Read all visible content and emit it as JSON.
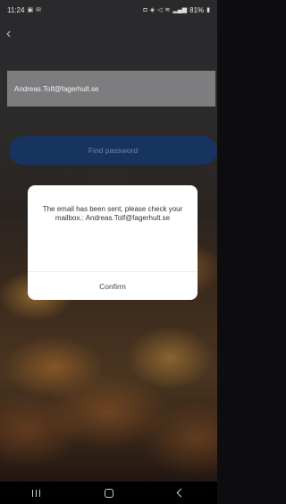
{
  "status_bar": {
    "time": "11:24",
    "battery": "81%",
    "left_icons": [
      "image-icon",
      "mail-icon"
    ],
    "right_icons": [
      "nfc-icon",
      "vibrate-icon",
      "mute-icon",
      "wifi-icon",
      "signal-icon",
      "battery-icon"
    ]
  },
  "form": {
    "email_value": "Andreas.Tolf@fagerhult.se",
    "find_password_label": "Find password"
  },
  "dialog": {
    "message": "The email has been sent, please check your mailbox.: Andreas.Tolf@fagerhult.se",
    "confirm_label": "Confirm"
  },
  "nav": {
    "icons": [
      "recent-apps-icon",
      "home-icon",
      "back-icon"
    ]
  },
  "colors": {
    "button_bg": "#17335f",
    "field_bg": "#7d7d80",
    "dialog_bg": "#ffffff"
  }
}
